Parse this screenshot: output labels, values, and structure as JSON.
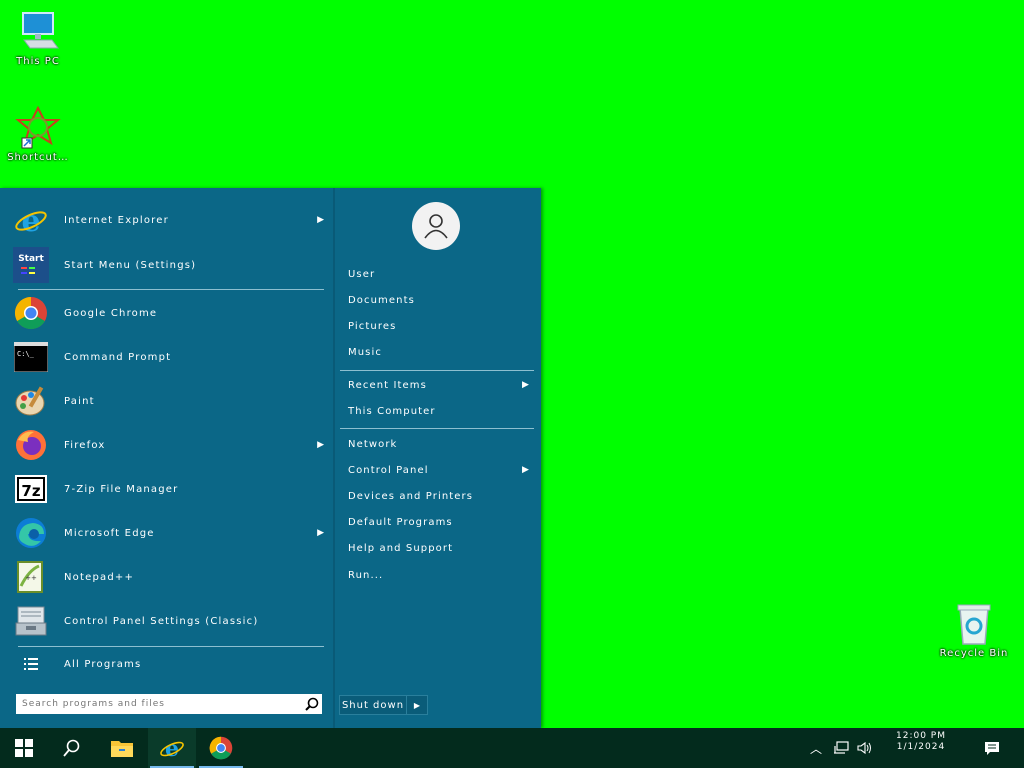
{
  "desktop": {
    "background": "#00FF00",
    "icons": [
      {
        "label": "This PC",
        "icon": "computer-icon"
      },
      {
        "label": "Shortcut…",
        "icon": "app-shortcut-icon"
      },
      {
        "label": "Recycle Bin",
        "icon": "recycle-bin-icon"
      }
    ]
  },
  "start_menu": {
    "apps": [
      {
        "label": "Internet Explorer",
        "icon": "internet-explorer-icon",
        "submenu": true
      },
      {
        "label": "Start Menu (Settings)",
        "icon": "start-menu-settings-icon",
        "submenu": false
      },
      {
        "label": "Google Chrome",
        "icon": "chrome-icon",
        "submenu": false
      },
      {
        "label": "Command Prompt",
        "icon": "command-prompt-icon",
        "submenu": false
      },
      {
        "label": "Paint",
        "icon": "paint-icon",
        "submenu": false
      },
      {
        "label": "Firefox",
        "icon": "firefox-icon",
        "submenu": true
      },
      {
        "label": "7-Zip File Manager",
        "icon": "7zip-icon",
        "submenu": false
      },
      {
        "label": "Microsoft Edge",
        "icon": "edge-icon",
        "submenu": true
      },
      {
        "label": "Notepad++",
        "icon": "notepadplusplus-icon",
        "submenu": false
      },
      {
        "label": "Control Panel Settings (Classic)",
        "icon": "control-panel-icon",
        "submenu": false
      }
    ],
    "all_programs_label": "All Programs",
    "search_placeholder": "Search programs and files",
    "right_items_group1": [
      {
        "label": "User",
        "submenu": false
      },
      {
        "label": "Documents",
        "submenu": false
      },
      {
        "label": "Pictures",
        "submenu": false
      },
      {
        "label": "Music",
        "submenu": false
      }
    ],
    "right_items_group2": [
      {
        "label": "Recent Items",
        "submenu": true
      },
      {
        "label": "This Computer",
        "submenu": false
      }
    ],
    "right_items_group3": [
      {
        "label": "Network",
        "submenu": false
      },
      {
        "label": "Control Panel",
        "submenu": true
      },
      {
        "label": "Devices and Printers",
        "submenu": false
      },
      {
        "label": "Default Programs",
        "submenu": false
      },
      {
        "label": "Help and Support",
        "submenu": false
      },
      {
        "label": "Run..."
      }
    ],
    "power_label": "Shut down"
  },
  "taskbar": {
    "clock_time": "12:00 PM",
    "clock_date": "1/1/2024"
  }
}
